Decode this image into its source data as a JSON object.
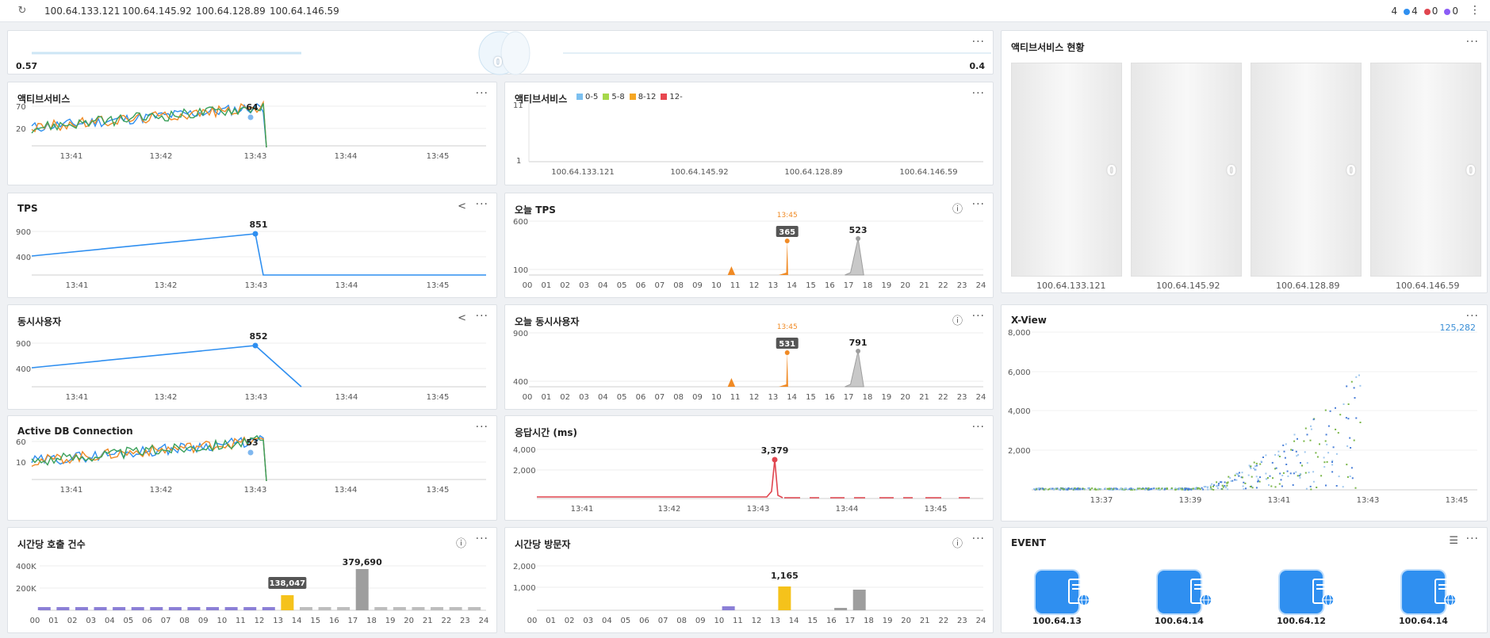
{
  "topbar": {
    "hosts": [
      "100.64.133.121",
      "100.64.145.92",
      "100.64.128.89",
      "100.64.146.59"
    ],
    "counts": {
      "total": "4",
      "blue": "4",
      "red": "0",
      "purple": "0"
    }
  },
  "colors": {
    "blue": "#2f8ff0",
    "orange": "#f08a24",
    "green": "#3aa05a",
    "red": "#e0454f",
    "purple": "#8b5cf6",
    "gray": "#9e9e9e",
    "yellow": "#f5c21b"
  },
  "speed": {
    "left_value": "0.57",
    "right_value": "0.4",
    "center_value": "0"
  },
  "active_service": {
    "title": "액티브서비스",
    "chart_data": {
      "type": "line",
      "x_ticks": [
        "13:41",
        "13:42",
        "13:43",
        "13:44",
        "13:45"
      ],
      "y_ticks": [
        "70",
        "20"
      ],
      "peak_label": "64",
      "series": [
        {
          "color": "#2f8ff0"
        },
        {
          "color": "#f08a24"
        },
        {
          "color": "#3aa05a"
        }
      ]
    }
  },
  "active_service_bar": {
    "title": "액티브서비스",
    "legend": [
      "0-5",
      "5-8",
      "8-12",
      "12-"
    ],
    "legend_colors": [
      "#7cc0f0",
      "#a6d84a",
      "#f5a623",
      "#e8474f"
    ],
    "chart_data": {
      "type": "bar",
      "categories": [
        "100.64.133.121",
        "100.64.145.92",
        "100.64.128.89",
        "100.64.146.59"
      ],
      "y_ticks": [
        "11",
        "1"
      ]
    }
  },
  "active_service_status": {
    "title": "액티브서비스 현황",
    "servers": [
      {
        "label": "100.64.133.121",
        "value": "0"
      },
      {
        "label": "100.64.145.92",
        "value": "0"
      },
      {
        "label": "100.64.128.89",
        "value": "0"
      },
      {
        "label": "100.64.146.59",
        "value": "0"
      }
    ]
  },
  "tps": {
    "title": "TPS",
    "chart_data": {
      "type": "line",
      "x_ticks": [
        "13:41",
        "13:42",
        "13:43",
        "13:44",
        "13:45"
      ],
      "y_ticks": [
        "900",
        "400"
      ],
      "peak_label": "851"
    }
  },
  "today_tps": {
    "title": "오늘 TPS",
    "chart_data": {
      "type": "area",
      "hours": [
        "00",
        "01",
        "02",
        "03",
        "04",
        "05",
        "06",
        "07",
        "08",
        "09",
        "10",
        "11",
        "12",
        "13",
        "14",
        "15",
        "16",
        "17",
        "18",
        "19",
        "20",
        "21",
        "22",
        "23",
        "24"
      ],
      "y_ticks": [
        "600",
        "100"
      ],
      "current_time": "13:45",
      "current_value": "365",
      "peak_label": "523"
    }
  },
  "concurrent": {
    "title": "동시사용자",
    "chart_data": {
      "type": "line",
      "x_ticks": [
        "13:41",
        "13:42",
        "13:43",
        "13:44",
        "13:45"
      ],
      "y_ticks": [
        "900",
        "400"
      ],
      "peak_label": "852"
    }
  },
  "today_concurrent": {
    "title": "오늘 동시사용자",
    "chart_data": {
      "type": "area",
      "hours": [
        "00",
        "01",
        "02",
        "03",
        "04",
        "05",
        "06",
        "07",
        "08",
        "09",
        "10",
        "11",
        "12",
        "13",
        "14",
        "15",
        "16",
        "17",
        "18",
        "19",
        "20",
        "21",
        "22",
        "23",
        "24"
      ],
      "y_ticks": [
        "900",
        "400"
      ],
      "current_time": "13:45",
      "current_value": "531",
      "peak_label": "791"
    }
  },
  "xview": {
    "title": "X-View",
    "total": "125,282",
    "chart_data": {
      "type": "scatter",
      "x_ticks": [
        "13:37",
        "13:39",
        "13:41",
        "13:43",
        "13:45"
      ],
      "y_ticks": [
        "8,000",
        "6,000",
        "4,000",
        "2,000"
      ]
    }
  },
  "db_conn": {
    "title": "Active DB Connection",
    "chart_data": {
      "type": "line",
      "x_ticks": [
        "13:41",
        "13:42",
        "13:43",
        "13:44",
        "13:45"
      ],
      "y_ticks": [
        "60",
        "10"
      ],
      "peak_label": "53"
    }
  },
  "response": {
    "title": "응답시간 (ms)",
    "chart_data": {
      "type": "line",
      "x_ticks": [
        "13:41",
        "13:42",
        "13:43",
        "13:44",
        "13:45"
      ],
      "y_ticks": [
        "4,000",
        "2,000"
      ],
      "peak_label": "3,379"
    }
  },
  "hourly_calls": {
    "title": "시간당 호출 건수",
    "chart_data": {
      "type": "bar",
      "hours": [
        "00",
        "01",
        "02",
        "03",
        "04",
        "05",
        "06",
        "07",
        "08",
        "09",
        "10",
        "11",
        "12",
        "13",
        "14",
        "15",
        "16",
        "17",
        "18",
        "19",
        "20",
        "21",
        "22",
        "23",
        "24"
      ],
      "y_ticks": [
        "400K",
        "200K"
      ],
      "current_label": "138,047",
      "peak_label": "379,690"
    }
  },
  "hourly_visitors": {
    "title": "시간당 방문자",
    "chart_data": {
      "type": "bar",
      "hours": [
        "00",
        "01",
        "02",
        "03",
        "04",
        "05",
        "06",
        "07",
        "08",
        "09",
        "10",
        "11",
        "12",
        "13",
        "14",
        "15",
        "16",
        "17",
        "18",
        "19",
        "20",
        "21",
        "22",
        "23",
        "24"
      ],
      "y_ticks": [
        "2,000",
        "1,000"
      ],
      "current_label": "1,165"
    }
  },
  "event": {
    "title": "EVENT",
    "servers": [
      {
        "label": "100.64.13"
      },
      {
        "label": "100.64.14"
      },
      {
        "label": "100.64.12"
      },
      {
        "label": "100.64.14"
      }
    ]
  }
}
